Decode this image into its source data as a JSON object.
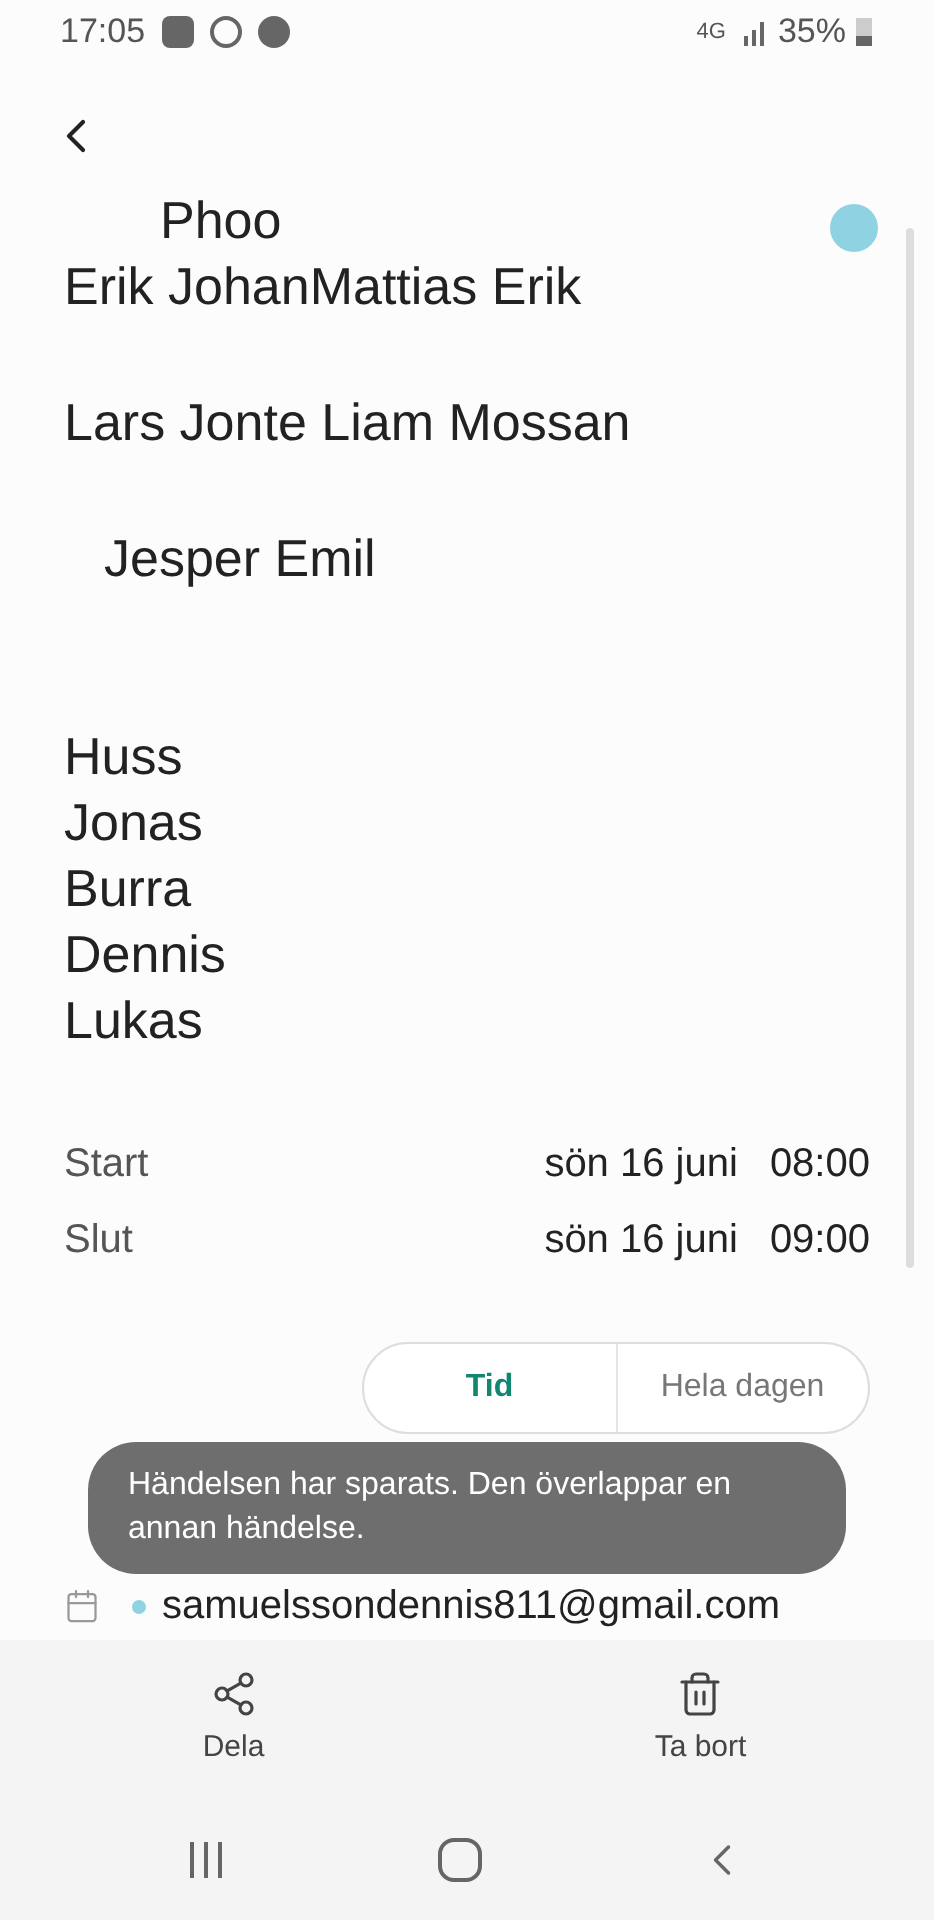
{
  "status_bar": {
    "time": "17:05",
    "network": "4G",
    "battery": "35%"
  },
  "event": {
    "title_lines": [
      "Phoo",
      "Erik JohanMattias Erik",
      "Lars Jonte Liam Mossan",
      "Jesper Emil",
      "Huss",
      "Jonas",
      "Burra",
      "Dennis",
      "Lukas"
    ],
    "color": "#8fd3e3"
  },
  "times": [
    {
      "label": "Start",
      "date": "sön 16 juni",
      "time": "08:00"
    },
    {
      "label": "Slut",
      "date": "sön 16 juni",
      "time": "09:00"
    }
  ],
  "mode_tabs": [
    {
      "label": "Tid",
      "selected": true
    },
    {
      "label": "Hela dagen",
      "selected": false
    }
  ],
  "toast": "Händelsen har sparats. Den överlappar en annan händelse.",
  "calendar": {
    "account": "samuelssondennis811@gmail.com",
    "color": "#8fd3e3"
  },
  "actions": [
    {
      "kind": "share",
      "label": "Dela"
    },
    {
      "kind": "delete",
      "label": "Ta bort"
    }
  ]
}
